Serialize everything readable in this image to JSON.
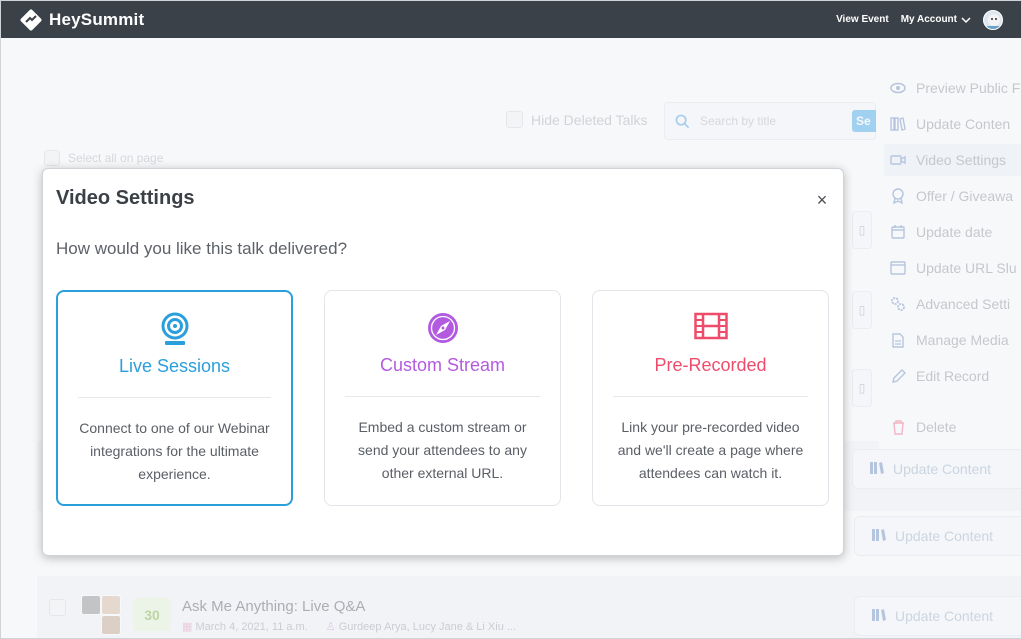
{
  "app": {
    "name": "HeySummit",
    "nav": {
      "view_event": "View Event",
      "my_account": "My Account"
    }
  },
  "toolbar": {
    "hide_deleted_label": "Hide Deleted Talks",
    "search_placeholder": "Search by title",
    "search_button": "Se",
    "select_all_label": "Select all on page"
  },
  "menu": {
    "items": [
      {
        "label": "Preview Public F",
        "icon": "eye-icon"
      },
      {
        "label": "Update Conten",
        "icon": "books-icon"
      },
      {
        "label": "Video Settings",
        "icon": "video-camera-icon"
      },
      {
        "label": "Offer / Giveawa",
        "icon": "badge-icon"
      },
      {
        "label": "Update date",
        "icon": "calendar-icon"
      },
      {
        "label": "Update URL Slu",
        "icon": "window-icon"
      },
      {
        "label": "Advanced Setti",
        "icon": "gears-icon"
      },
      {
        "label": "Manage Media",
        "icon": "file-icon"
      },
      {
        "label": "Edit Record",
        "icon": "pencil-icon"
      },
      {
        "label": "Delete",
        "icon": "trash-icon"
      }
    ]
  },
  "update_buttons": [
    {
      "label": "Update Content"
    },
    {
      "label": "Update Content"
    },
    {
      "label": "Update Content"
    }
  ],
  "talk_row": {
    "count": "30",
    "title": "Ask Me Anything: Live Q&A",
    "date": "March 4, 2021, 11 a.m.",
    "speakers": "Gurdeep Arya, Lucy Jane & Li Xiu ..."
  },
  "modal": {
    "title": "Video Settings",
    "close": "×",
    "subtitle": "How would you like this talk delivered?",
    "options": [
      {
        "title": "Live Sessions",
        "description": "Connect to one of our Webinar integrations for the ultimate experience.",
        "color": "#2b9fdc",
        "icon": "webcam-icon",
        "selected": true
      },
      {
        "title": "Custom Stream",
        "description": "Embed a custom stream or send your attendees to any other external URL.",
        "color": "#b35be0",
        "icon": "compass-icon",
        "selected": false
      },
      {
        "title": "Pre-Recorded",
        "description": "Link your pre-recorded video and we'll create a page where attendees can watch it.",
        "color": "#ef4c6c",
        "icon": "film-icon",
        "selected": false
      }
    ]
  },
  "colors": {
    "topbar": "#3b4148",
    "accent_blue": "#2b9fdc",
    "accent_purple": "#b35be0",
    "accent_red": "#ef4c6c"
  }
}
